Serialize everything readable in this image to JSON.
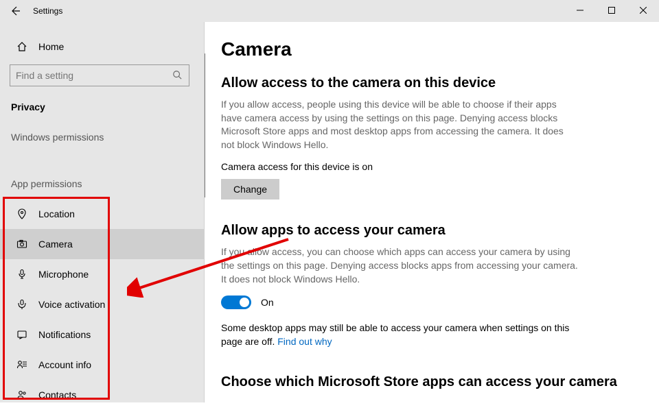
{
  "window": {
    "title": "Settings"
  },
  "sidebar": {
    "home_label": "Home",
    "search_placeholder": "Find a setting",
    "category": "Privacy",
    "section_windows": "Windows permissions",
    "section_app": "App permissions",
    "items": [
      {
        "label": "Location"
      },
      {
        "label": "Camera"
      },
      {
        "label": "Microphone"
      },
      {
        "label": "Voice activation"
      },
      {
        "label": "Notifications"
      },
      {
        "label": "Account info"
      },
      {
        "label": "Contacts"
      }
    ]
  },
  "main": {
    "page_title": "Camera",
    "section1": {
      "heading": "Allow access to the camera on this device",
      "body": "If you allow access, people using this device will be able to choose if their apps have camera access by using the settings on this page. Denying access blocks Microsoft Store apps and most desktop apps from accessing the camera. It does not block Windows Hello.",
      "status": "Camera access for this device is on",
      "change_btn": "Change"
    },
    "section2": {
      "heading": "Allow apps to access your camera",
      "body": "If you allow access, you can choose which apps can access your camera by using the settings on this page. Denying access blocks apps from accessing your camera. It does not block Windows Hello.",
      "toggle_label": "On",
      "note_prefix": "Some desktop apps may still be able to access your camera when settings on this page are off. ",
      "note_link": "Find out why"
    },
    "section3": {
      "heading": "Choose which Microsoft Store apps can access your camera"
    }
  }
}
